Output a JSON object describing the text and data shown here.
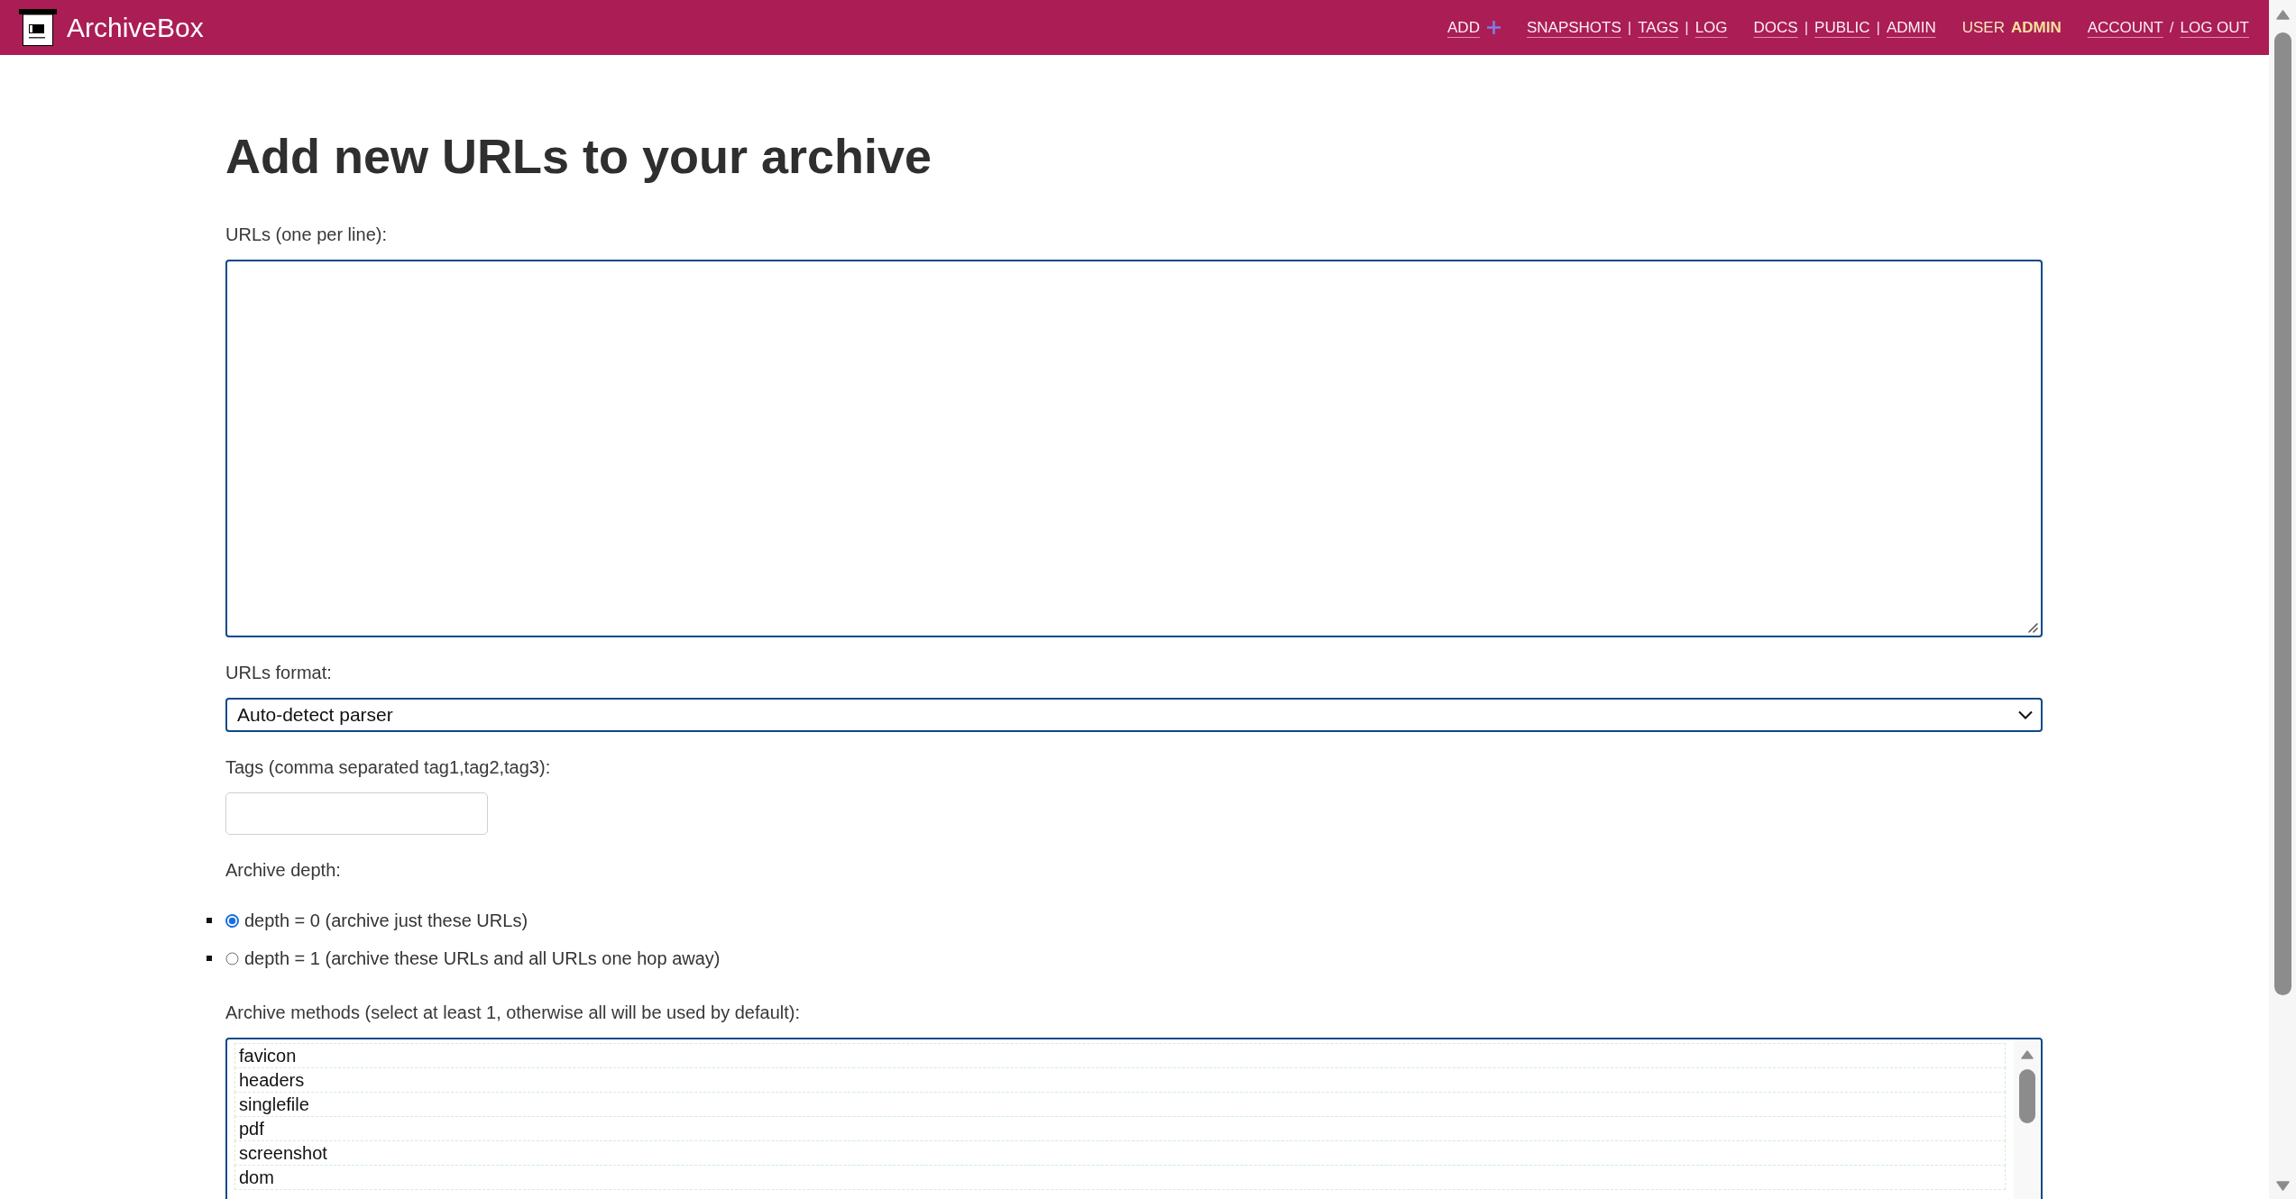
{
  "header": {
    "brand": "ArchiveBox",
    "nav_groups": [
      {
        "items": [
          {
            "kind": "action",
            "label": "ADD"
          }
        ]
      },
      {
        "items": [
          {
            "kind": "link",
            "label": "SNAPSHOTS"
          },
          {
            "kind": "separator",
            "label": "|"
          },
          {
            "kind": "link",
            "label": "TAGS"
          },
          {
            "kind": "separator",
            "label": "|"
          },
          {
            "kind": "link",
            "label": "LOG"
          }
        ]
      },
      {
        "items": [
          {
            "kind": "link",
            "label": "DOCS"
          },
          {
            "kind": "separator",
            "label": "|"
          },
          {
            "kind": "link",
            "label": "PUBLIC"
          },
          {
            "kind": "separator",
            "label": "|"
          },
          {
            "kind": "link",
            "label": "ADMIN"
          }
        ]
      },
      {
        "items": [
          {
            "kind": "text",
            "label": "USER"
          },
          {
            "kind": "strong",
            "label": "ADMIN"
          }
        ]
      },
      {
        "items": [
          {
            "kind": "link",
            "label": "ACCOUNT"
          },
          {
            "kind": "separator",
            "label": "/"
          },
          {
            "kind": "link",
            "label": "LOG OUT"
          }
        ]
      }
    ]
  },
  "form": {
    "title": "Add new URLs to your archive",
    "fields": [
      {
        "kind": "textarea",
        "label": "URLs (one per line):"
      },
      {
        "kind": "select",
        "label": "URLs format:",
        "value": "Auto-detect parser"
      },
      {
        "kind": "text",
        "label": "Tags (comma separated tag1,tag2,tag3):"
      },
      {
        "kind": "radio",
        "label": "Archive depth:",
        "options": [
          {
            "label": "depth = 0 (archive just these URLs)",
            "selected": true
          },
          {
            "label": "depth = 1 (archive these URLs and all URLs one hop away)",
            "selected": false
          }
        ]
      },
      {
        "kind": "multiselect",
        "label": "Archive methods (select at least 1, otherwise all will be used by default):",
        "options": [
          {
            "label": "favicon",
            "selected": false
          },
          {
            "label": "headers",
            "selected": false
          },
          {
            "label": "singlefile",
            "selected": false
          },
          {
            "label": "pdf",
            "selected": false
          },
          {
            "label": "screenshot",
            "selected": false
          },
          {
            "label": "dom",
            "selected": false
          }
        ]
      }
    ]
  }
}
